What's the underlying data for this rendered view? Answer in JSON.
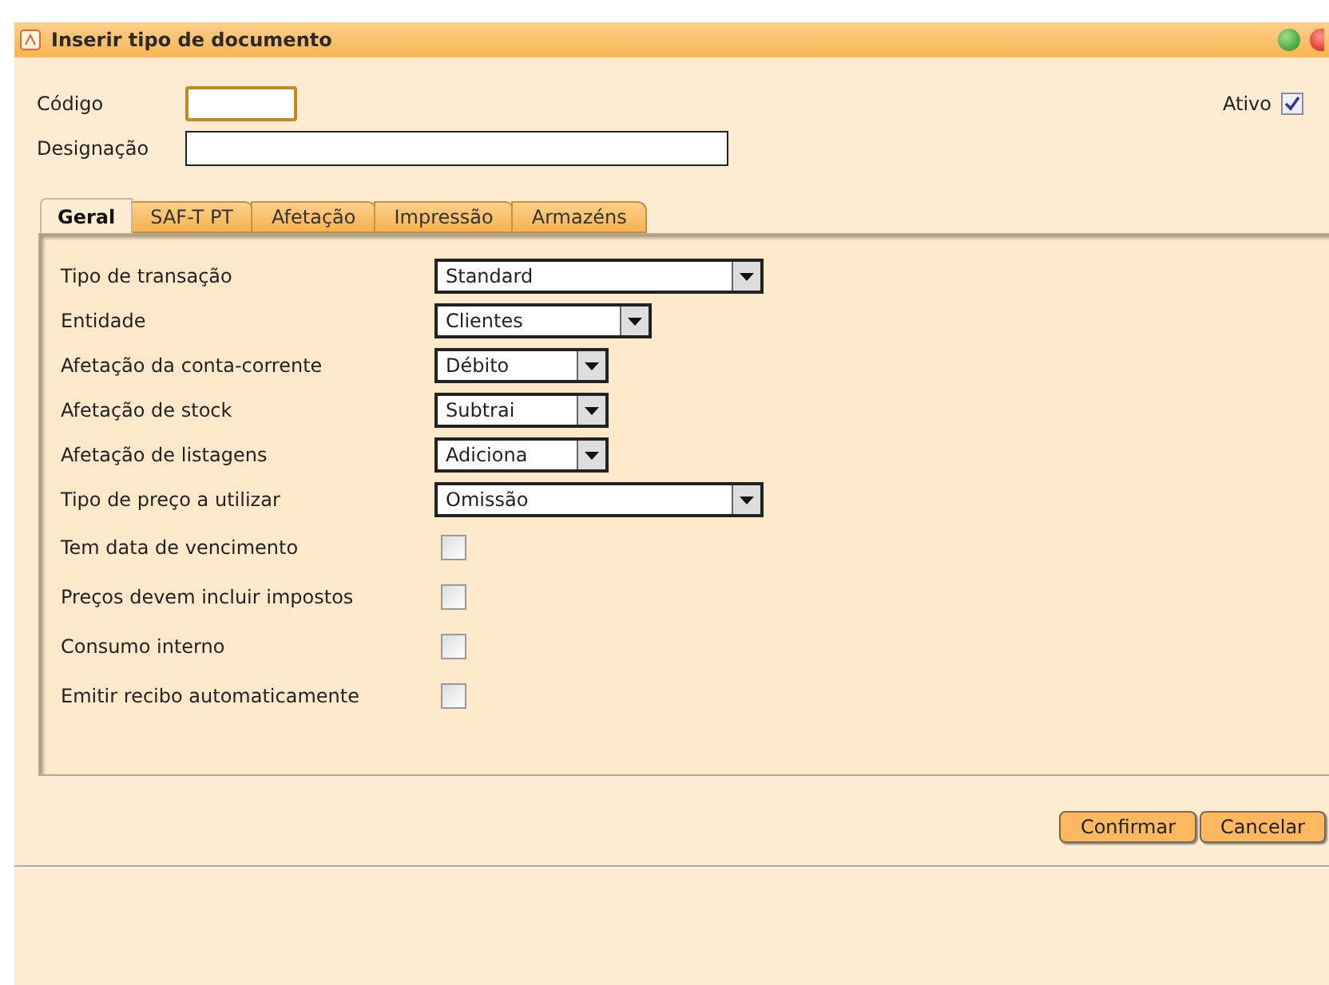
{
  "window": {
    "title": "Inserir tipo de documento"
  },
  "codigo": {
    "label": "Código"
  },
  "designacao": {
    "label": "Designação"
  },
  "ativo": {
    "label": "Ativo",
    "checked": true
  },
  "tabs": [
    {
      "label": "Geral",
      "selected": true
    },
    {
      "label": "SAF-T PT",
      "selected": false
    },
    {
      "label": "Afetação",
      "selected": false
    },
    {
      "label": "Impressão",
      "selected": false
    },
    {
      "label": "Armazéns",
      "selected": false
    }
  ],
  "fields": [
    {
      "kind": "select",
      "label": "Tipo de transação",
      "value": "Standard"
    },
    {
      "kind": "select",
      "label": "Entidade",
      "value": "Clientes"
    },
    {
      "kind": "select",
      "label": "Afetação da conta-corrente",
      "value": "Débito"
    },
    {
      "kind": "select",
      "label": "Afetação de stock",
      "value": "Subtrai"
    },
    {
      "kind": "select",
      "label": "Afetação de listagens",
      "value": "Adiciona"
    },
    {
      "kind": "select",
      "label": "Tipo de preço a utilizar",
      "value": "Omissão"
    },
    {
      "kind": "checkbox",
      "label": "Tem data de vencimento",
      "checked": false
    },
    {
      "kind": "checkbox",
      "label": "Preços devem incluir impostos",
      "checked": false
    },
    {
      "kind": "checkbox",
      "label": "Consumo interno",
      "checked": false
    },
    {
      "kind": "checkbox",
      "label": "Emitir recibo automaticamente",
      "checked": false
    }
  ],
  "buttons": [
    "Confirmar",
    "Cancelar"
  ]
}
